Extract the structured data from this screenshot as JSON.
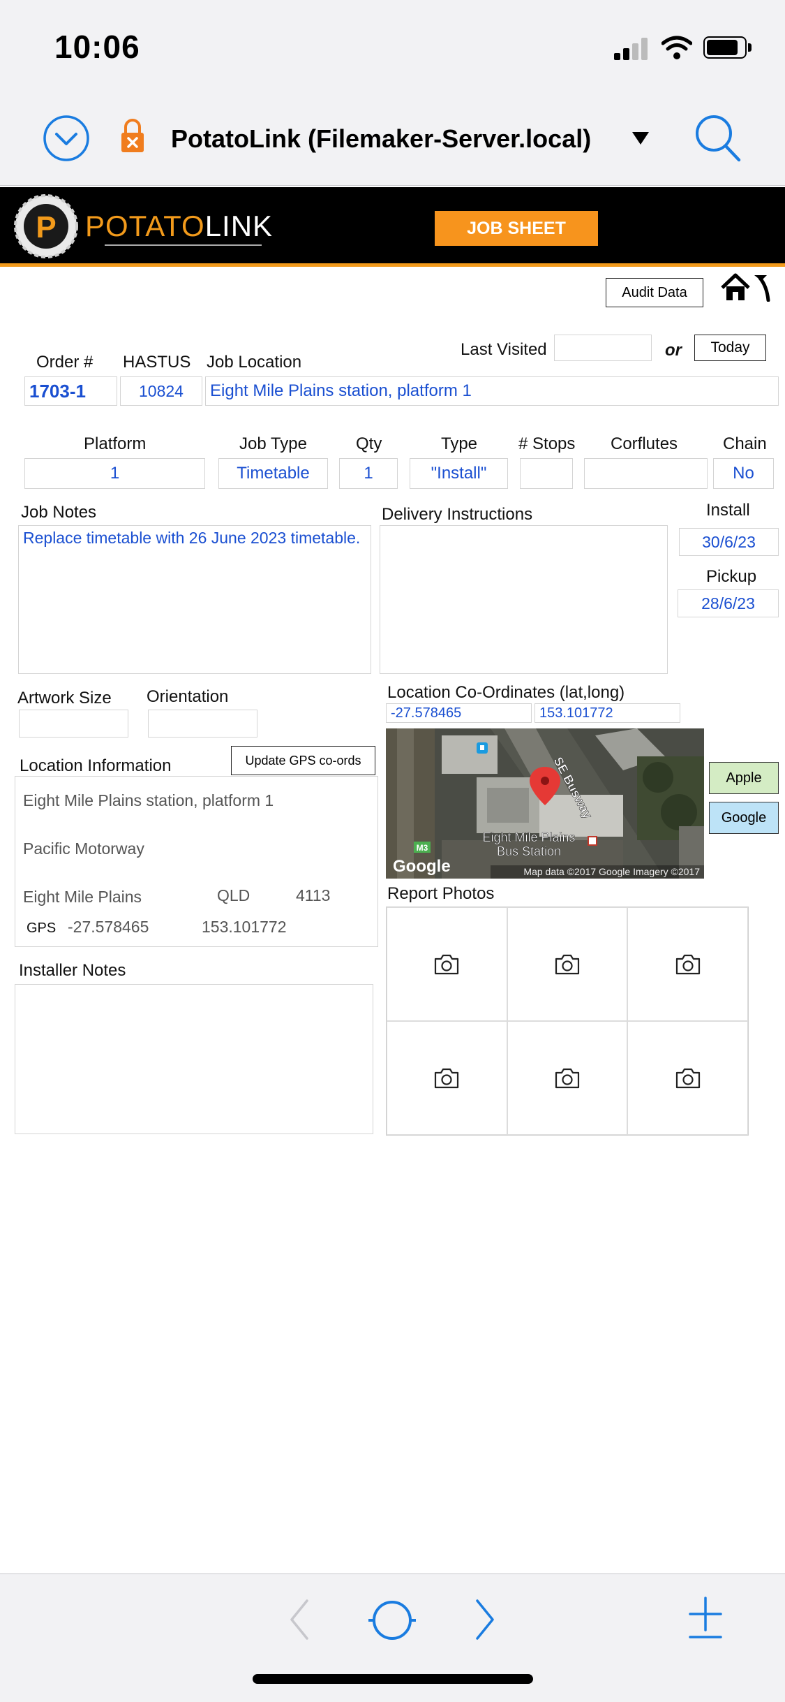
{
  "status_bar": {
    "time": "10:06"
  },
  "browser": {
    "title": "PotatoLink (Filemaker-Server.local)"
  },
  "header": {
    "logo_prefix": "POTATO",
    "logo_suffix": "LINK",
    "job_sheet_label": "JOB SHEET"
  },
  "toolbar": {
    "audit_label": "Audit Data"
  },
  "last_visited": {
    "label": "Last Visited",
    "value": "",
    "or_label": "or",
    "today_label": "Today"
  },
  "order": {
    "order_label": "Order #",
    "order_value": "1703-1",
    "hastus_label": "HASTUS",
    "hastus_value": "10824",
    "location_label": "Job Location",
    "location_value": "Eight Mile Plains station, platform 1"
  },
  "details": {
    "platform_label": "Platform",
    "platform_value": "1",
    "job_type_label": "Job Type",
    "job_type_value": "Timetable",
    "qty_label": "Qty",
    "qty_value": "1",
    "type_label": "Type",
    "type_value": "\"Install\"",
    "stops_label": "# Stops",
    "stops_value": "",
    "corflutes_label": "Corflutes",
    "corflutes_value": "",
    "chain_label": "Chain",
    "chain_value": "No"
  },
  "notes": {
    "job_notes_label": "Job Notes",
    "job_notes_value": "Replace timetable with 26 June 2023 timetable.",
    "delivery_label": "Delivery Instructions",
    "delivery_value": "",
    "install_label": "Install",
    "install_value": "30/6/23",
    "pickup_label": "Pickup",
    "pickup_value": "28/6/23"
  },
  "artwork": {
    "size_label": "Artwork Size",
    "size_value": "",
    "orientation_label": "Orientation",
    "orientation_value": ""
  },
  "coords": {
    "label": "Location Co-Ordinates (lat,long)",
    "lat": "-27.578465",
    "long": "153.101772"
  },
  "location_info": {
    "label": "Location Information",
    "update_button": "Update GPS co-ords",
    "line1": "Eight Mile Plains station, platform 1",
    "line2": "Pacific Motorway",
    "suburb": "Eight Mile Plains",
    "state": "QLD",
    "postcode": "4113",
    "gps_label": "GPS",
    "gps_lat": "-27.578465",
    "gps_long": "153.101772"
  },
  "map": {
    "road_label": "SE Busway",
    "station_label_1": "Eight Mile Plains",
    "station_label_2": "Bus Station",
    "route_badge": "M3",
    "brand": "Google",
    "attribution": "Map data ©2017 Google  Imagery ©2017"
  },
  "map_buttons": {
    "apple": "Apple",
    "google": "Google"
  },
  "photos": {
    "label": "Report Photos"
  },
  "installer": {
    "label": "Installer Notes",
    "value": ""
  },
  "colors": {
    "brand_orange": "#f7941d",
    "field_text": "#1a4fd1",
    "apple_btn": "#d4ecc4",
    "google_btn": "#bde3f7",
    "ios_blue": "#1a7ce0"
  }
}
